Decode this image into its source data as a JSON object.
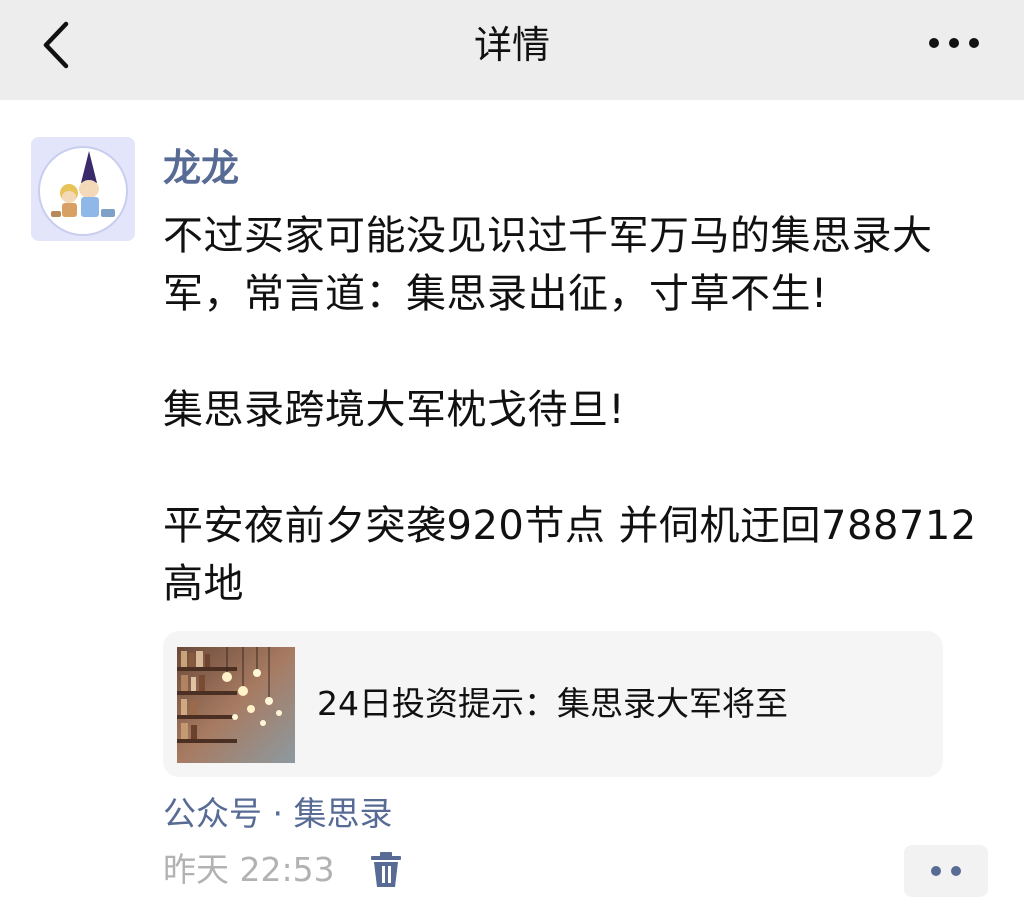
{
  "nav": {
    "title": "详情"
  },
  "post": {
    "author": "龙龙",
    "paragraphs": [
      "不过买家可能没见识过千军万马的集思录大军，常言道：集思录出征，寸草不生!",
      "集思录跨境大军枕戈待旦!",
      "平安夜前夕突袭920节点 并伺机迂回788712高地"
    ],
    "link_card": {
      "title": "24日投资提示：集思录大军将至"
    },
    "source": "公众号 · 集思录",
    "time": "昨天 22:53"
  },
  "icons": {
    "back": "chevron-left-icon",
    "more": "more-dots-icon",
    "delete": "trash-icon",
    "actions": "two-dots-icon"
  },
  "colors": {
    "nav_background": "#ededed",
    "author_link": "#576b95",
    "timestamp": "#b2b2b2",
    "card_background": "#f5f5f5"
  }
}
